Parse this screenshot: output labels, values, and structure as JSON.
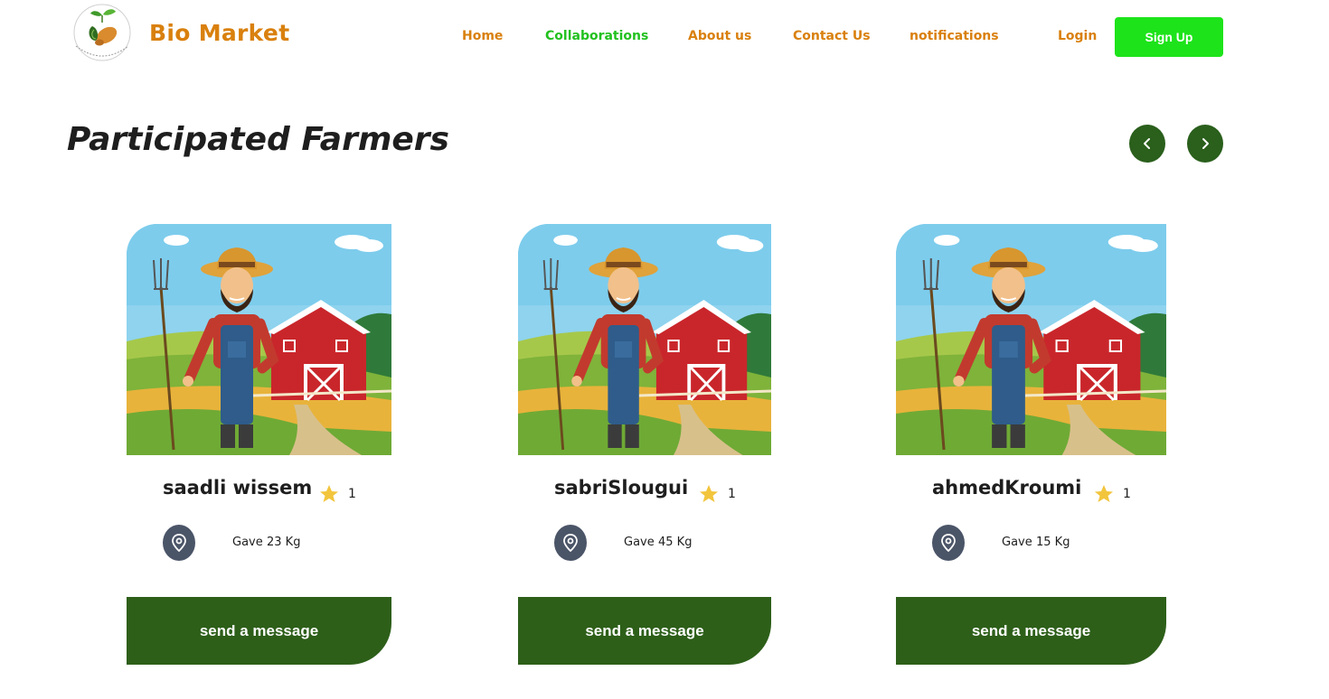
{
  "brand": {
    "name": "Bio Market",
    "logo_icon": "leaf-sweetpotato-logo"
  },
  "nav": {
    "items": [
      {
        "label": "Home",
        "active": false
      },
      {
        "label": "Collaborations",
        "active": true
      },
      {
        "label": "About us",
        "active": false
      },
      {
        "label": "Contact Us",
        "active": false
      },
      {
        "label": "notifications",
        "active": false
      }
    ],
    "login_label": "Login",
    "signup_label": "Sign Up"
  },
  "section": {
    "title": "Participated Farmers",
    "prev_icon": "chevron-left-icon",
    "next_icon": "chevron-right-icon"
  },
  "farmers": [
    {
      "name": "saadli wissem",
      "rating": "1",
      "gave_label": "Gave",
      "gave_value": "23 Kg",
      "button_label": "send a message"
    },
    {
      "name": "sabriSlougui",
      "rating": "1",
      "gave_label": "Gave",
      "gave_value": "45 Kg",
      "button_label": "send a message"
    },
    {
      "name": "ahmedKroumi",
      "rating": "1",
      "gave_label": "Gave",
      "gave_value": "15 Kg",
      "button_label": "send a message"
    }
  ],
  "colors": {
    "brand_orange": "#d9800e",
    "nav_active_green": "#22c11f",
    "signup_green": "#1de31a",
    "dark_green": "#2d5f19",
    "location_badge": "#4b5568",
    "star_yellow": "#f2c53d"
  }
}
